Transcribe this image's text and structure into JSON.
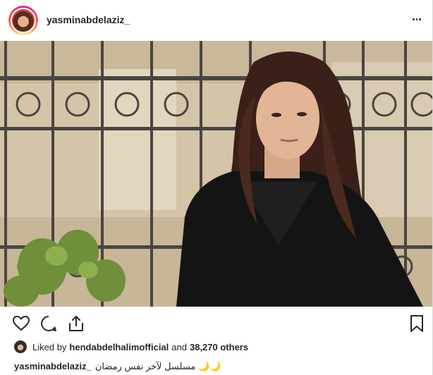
{
  "header": {
    "username": "yasminabdelaziz_",
    "avatar_icon": "profile-avatar",
    "more_icon": "more-options-icon"
  },
  "photo": {
    "alt_subject": "woman in black coat in front of iron fence"
  },
  "actions": {
    "like_icon": "heart-icon",
    "comment_icon": "comment-icon",
    "share_icon": "share-icon",
    "save_icon": "bookmark-icon"
  },
  "likes": {
    "prefix": "Liked by",
    "user": "hendabdelhalimofficial",
    "and": "and",
    "count": "38,270 others"
  },
  "caption": {
    "username": "yasminabdelaziz_",
    "text": "مسلسل لآخر نفس رمضان 🌙🌙"
  },
  "colors": {
    "text": "#262626",
    "border": "#dbdbdb"
  }
}
